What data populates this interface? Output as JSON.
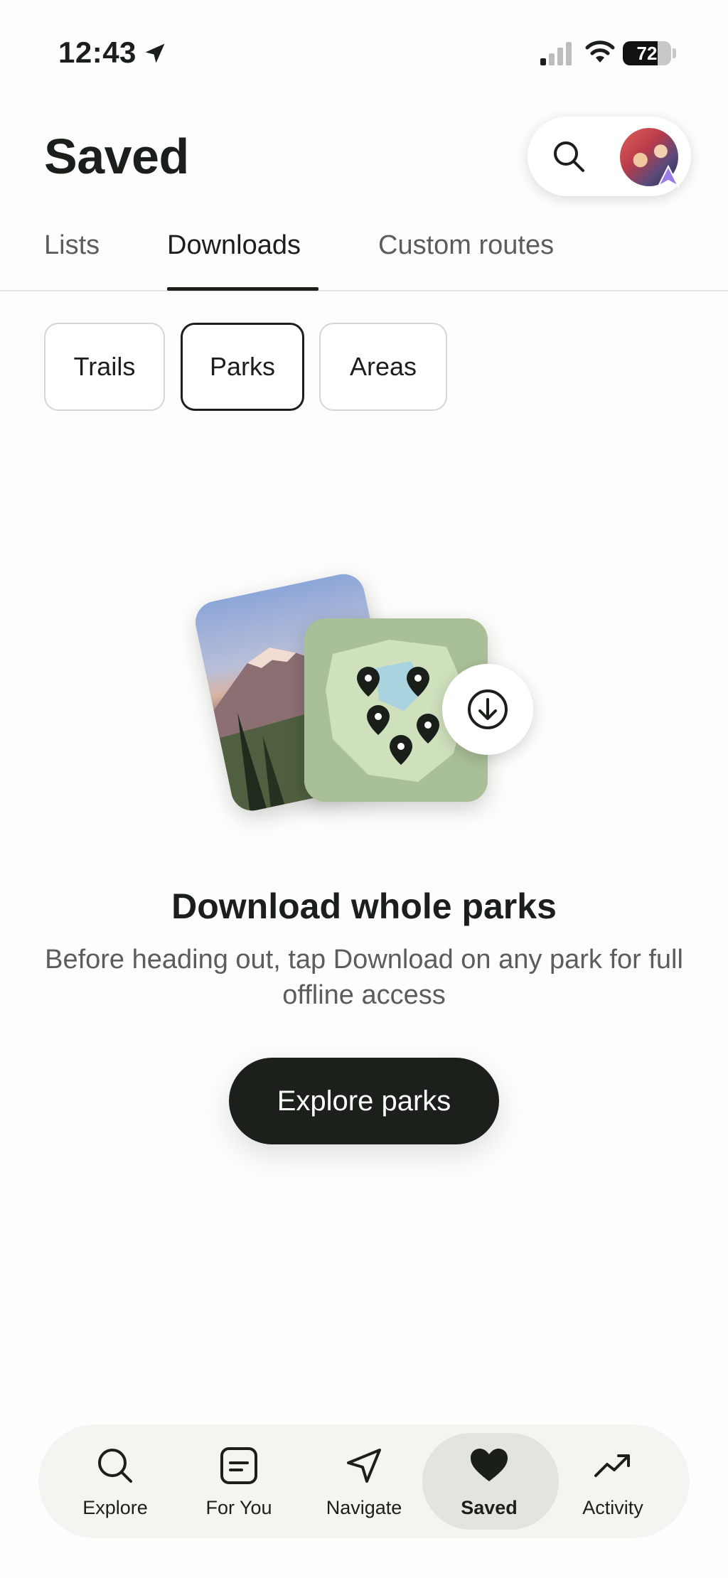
{
  "status_bar": {
    "time": "12:43",
    "battery": "72",
    "battery_level": 0.72
  },
  "header": {
    "title": "Saved"
  },
  "tabs": [
    {
      "label": "Lists"
    },
    {
      "label": "Downloads"
    },
    {
      "label": "Custom routes"
    }
  ],
  "active_tab": "Downloads",
  "filters": [
    {
      "label": "Trails"
    },
    {
      "label": "Parks"
    },
    {
      "label": "Areas"
    }
  ],
  "active_filter": "Parks",
  "empty_state": {
    "title": "Download whole parks",
    "body": "Before heading out, tap Download on any park for full offline access",
    "button_label": "Explore parks"
  },
  "bottom_nav": [
    {
      "label": "Explore",
      "icon": "search-icon"
    },
    {
      "label": "For You",
      "icon": "feed-icon"
    },
    {
      "label": "Navigate",
      "icon": "navigate-icon"
    },
    {
      "label": "Saved",
      "icon": "heart-icon"
    },
    {
      "label": "Activity",
      "icon": "activity-icon"
    }
  ],
  "active_nav": "Saved",
  "colors": {
    "accent": "#1b211a",
    "background": "#fdfdfb",
    "muted_text": "#5a5e58"
  }
}
